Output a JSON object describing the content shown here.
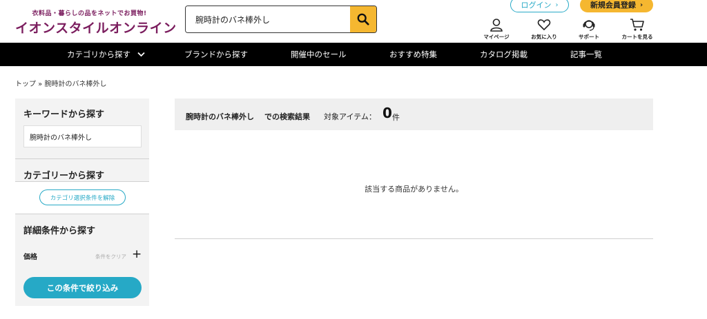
{
  "brand": {
    "tagline": "衣料品・暮らしの品をネットでお買物!",
    "name": "イオンスタイルオンライン",
    "color": "#7b1d5e"
  },
  "search": {
    "value": "腕時計のバネ棒外し",
    "button_icon": "search-icon",
    "button_color": "#f5b730"
  },
  "account": {
    "login_label": "ログイン",
    "register_label": "新規会員登録"
  },
  "utilities": [
    {
      "label": "マイページ",
      "icon": "user-icon"
    },
    {
      "label": "お気に入り",
      "icon": "heart-icon"
    },
    {
      "label": "サポート",
      "icon": "headset-icon"
    },
    {
      "label": "カートを見る",
      "icon": "cart-icon"
    }
  ],
  "nav": {
    "items": [
      {
        "label": "カテゴリから探す"
      },
      {
        "label": "ブランドから探す"
      },
      {
        "label": "開催中のセール"
      },
      {
        "label": "おすすめ特集"
      },
      {
        "label": "カタログ掲載"
      },
      {
        "label": "記事一覧"
      }
    ]
  },
  "breadcrumb": "トップ » 腕時計のバネ棒外し",
  "sidebar": {
    "keyword_heading": "キーワードから探す",
    "keyword_value": "腕時計のバネ棒外し",
    "category_heading": "カテゴリーから探す",
    "clear_category_label": "カテゴリ選択条件を解除",
    "detail_heading": "詳細条件から探す",
    "price_label": "価格",
    "clear_condition_label": "条件をクリア",
    "filter_button_label": "この条件で絞り込み",
    "accent_color": "#26a9c6"
  },
  "results": {
    "query": "腕時計のバネ棒外し",
    "query_suffix": "での検索結果",
    "target_label": "対象アイテム：",
    "count": "0",
    "count_unit": "件",
    "empty_message": "該当する商品がありません。"
  }
}
